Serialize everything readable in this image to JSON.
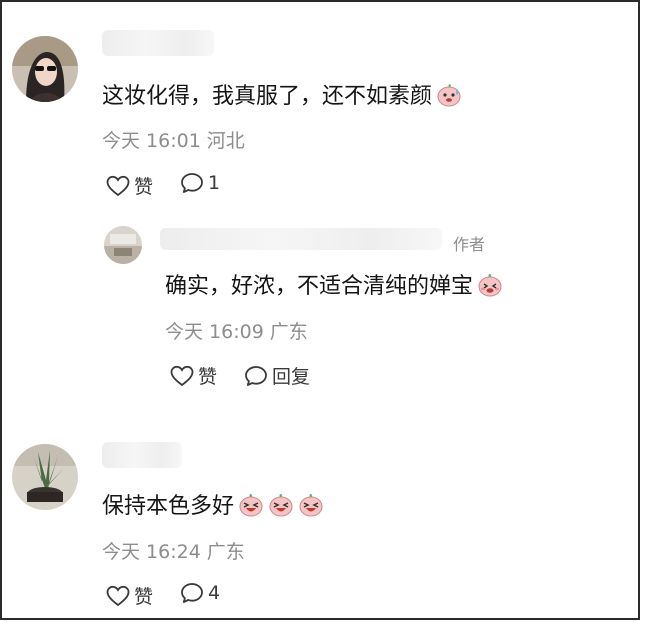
{
  "comments": [
    {
      "content": "这妆化得，我真服了，还不如素颜",
      "time": "今天 16:01",
      "location": "河北",
      "like_label": "赞",
      "reply_count": "1",
      "emoji_icons": [
        "sweating-face-emoji-icon"
      ]
    },
    {
      "author_tag": "作者",
      "content": "确实，好浓，不适合清纯的婵宝",
      "time": "今天 16:09",
      "location": "广东",
      "like_label": "赞",
      "reply_label": "回复",
      "emoji_icons": [
        "shy-face-emoji-icon"
      ]
    },
    {
      "content": "保持本色多好",
      "time": "今天 16:24",
      "location": "广东",
      "like_label": "赞",
      "reply_count": "4",
      "emoji_icons": [
        "laughing-face-emoji-icon",
        "laughing-face-emoji-icon",
        "laughing-face-emoji-icon"
      ]
    }
  ],
  "colors": {
    "text": "#151515",
    "meta": "#8d8d8d",
    "border": "#2b2b2b",
    "emoji_face": "#f7c6c6",
    "emoji_leaf": "#5db37a"
  }
}
